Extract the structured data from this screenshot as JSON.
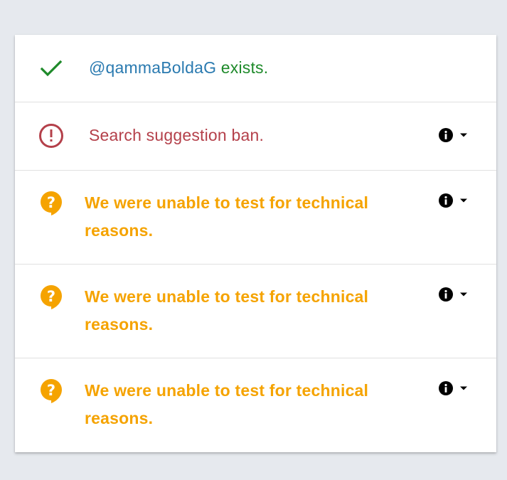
{
  "results": [
    {
      "status": "ok",
      "icon": "check-icon",
      "username": "@qammaBoldaG",
      "text": " exists.",
      "color": "#1e8a2a"
    },
    {
      "status": "ban",
      "icon": "alert-circle-icon",
      "text": "Search suggestion ban.",
      "color": "#b4404a",
      "has_actions": true
    },
    {
      "status": "unknown",
      "icon": "question-bubble-icon",
      "text": "We were unable to test for technical reasons.",
      "color": "#f5a300",
      "has_actions": true
    },
    {
      "status": "unknown",
      "icon": "question-bubble-icon",
      "text": "We were unable to test for technical reasons.",
      "color": "#f5a300",
      "has_actions": true
    },
    {
      "status": "unknown",
      "icon": "question-bubble-icon",
      "text": "We were unable to test for technical reasons.",
      "color": "#f5a300",
      "has_actions": true
    }
  ],
  "action_icons": [
    "info-icon",
    "dropdown-arrow-icon"
  ]
}
